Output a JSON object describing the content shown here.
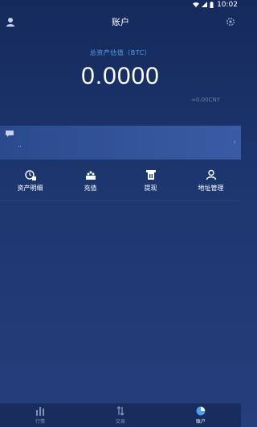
{
  "status": {
    "time": "10:02"
  },
  "header": {
    "title": "账户",
    "left_icon": "user-icon",
    "right_icon": "gear-icon"
  },
  "assets": {
    "label": "总资产估值（BTC）",
    "value": "0.0000",
    "cny": "≈0.00CNY"
  },
  "notice": {
    "icon": "message-icon",
    "subtitle": "··",
    "arrow": "›"
  },
  "actions": [
    {
      "label": "资产明细",
      "icon": "asset-detail-icon"
    },
    {
      "label": "充值",
      "icon": "deposit-icon"
    },
    {
      "label": "提现",
      "icon": "withdraw-icon"
    },
    {
      "label": "地址管理",
      "icon": "address-icon"
    }
  ],
  "tabs": [
    {
      "label": "行情",
      "icon": "market-icon",
      "active": false
    },
    {
      "label": "交易",
      "icon": "trade-icon",
      "active": false
    },
    {
      "label": "账户",
      "icon": "account-icon",
      "active": true
    }
  ],
  "colors": {
    "accent": "#5a9ce8",
    "active_tab": "#4f9cf0",
    "background_top": "#152a5c",
    "background_bottom": "#243f7c"
  }
}
